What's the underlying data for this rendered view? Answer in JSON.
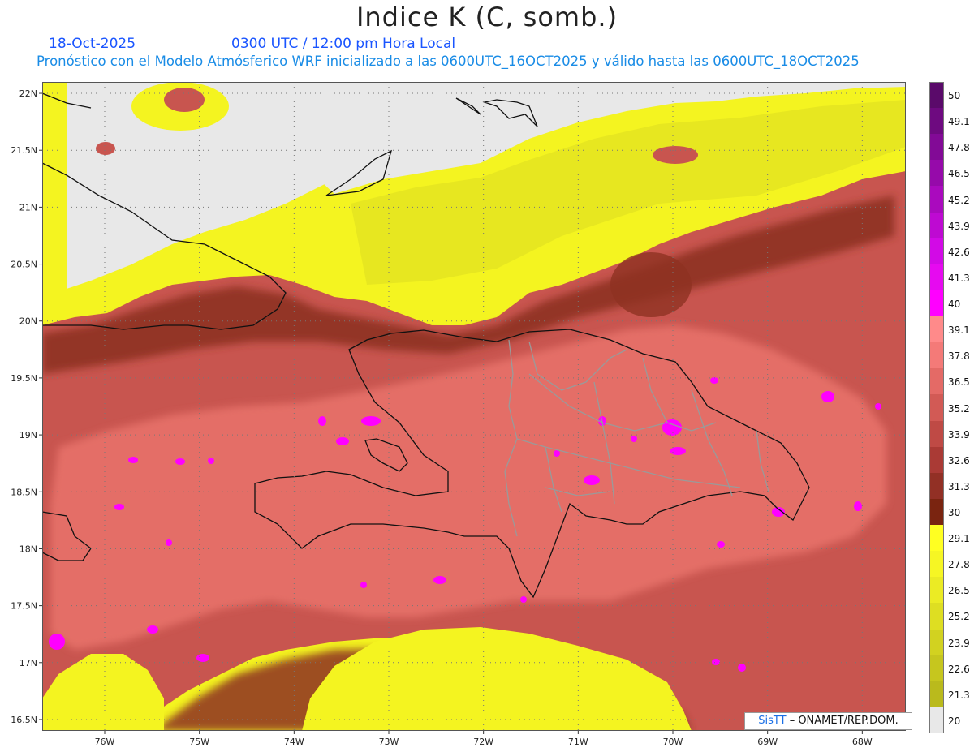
{
  "header": {
    "title": "Indice K (C, somb.)",
    "date": "18-Oct-2025",
    "time": "0300 UTC / 12:00 pm Hora Local",
    "description": "Pronóstico con el Modelo Atmósferico WRF inicializado a las 0600UTC_16OCT2025 y válido hasta las  0600UTC_18OCT2025"
  },
  "map": {
    "lat_labels": [
      "22N",
      "21.5N",
      "21N",
      "20.5N",
      "20N",
      "19.5N",
      "19N",
      "18.5N",
      "18N",
      "17.5N",
      "17N",
      "16.5N"
    ],
    "lon_labels": [
      "76W",
      "75W",
      "74W",
      "73W",
      "72W",
      "71W",
      "70W",
      "69W",
      "68W"
    ],
    "lat_range": [
      16.4,
      22.1
    ],
    "lon_range": [
      -76.66,
      -67.54
    ]
  },
  "legend": {
    "levels": [
      "50",
      "49.1",
      "47.8",
      "46.5",
      "45.2",
      "43.9",
      "42.6",
      "41.3",
      "40",
      "39.1",
      "37.8",
      "36.5",
      "35.2",
      "33.9",
      "32.6",
      "31.3",
      "30",
      "29.1",
      "27.8",
      "26.5",
      "25.2",
      "23.9",
      "22.6",
      "21.3",
      "20"
    ],
    "colors": [
      "#5a0a6a",
      "#6e0a80",
      "#820a96",
      "#960aaa",
      "#aa0abe",
      "#be0ad2",
      "#d20ae6",
      "#e60af0",
      "#ff00ff",
      "#ff8a8a",
      "#f47a78",
      "#e46a66",
      "#d25a55",
      "#bf4a45",
      "#aa3a35",
      "#923025",
      "#7a2410",
      "#ffff22",
      "#f6f624",
      "#ebeb24",
      "#dede22",
      "#d2d220",
      "#c6c61e",
      "#baba1c",
      "#e8e8e8"
    ]
  },
  "credit": {
    "brand": "SisTT",
    "text": " – ONAMET/REP.DOM."
  }
}
